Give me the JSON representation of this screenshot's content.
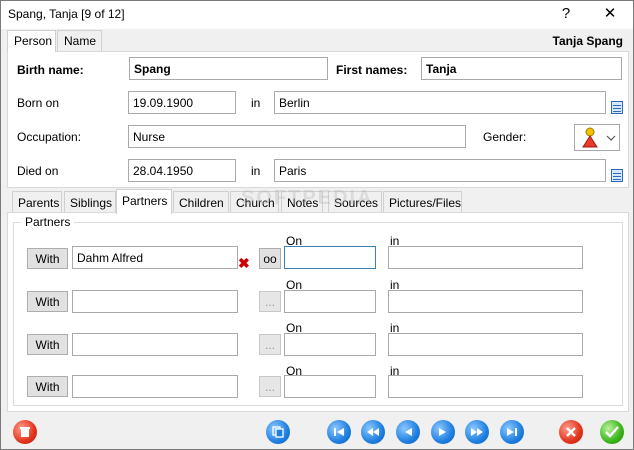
{
  "window": {
    "title": "Spang, Tanja [9 of 12]",
    "help_icon": "?",
    "close_icon": "✕"
  },
  "top_tabs": [
    {
      "label": "Person"
    },
    {
      "label": "Name"
    }
  ],
  "header": {
    "person_name": "Tanja Spang"
  },
  "person": {
    "birth_name_label": "Birth name:",
    "birth_name": "Spang",
    "first_names_label": "First names:",
    "first_names": "Tanja",
    "born_on_label": "Born on",
    "born_on": "19.09.1900",
    "born_in_label": "in",
    "born_in": "Berlin",
    "occupation_label": "Occupation:",
    "occupation": "Nurse",
    "gender_label": "Gender:",
    "gender_icon": "female-person-icon",
    "died_on_label": "Died on",
    "died_on": "28.04.1950",
    "died_in_label": "in",
    "died_in": "Paris"
  },
  "sub_tabs": [
    {
      "label": "Parents"
    },
    {
      "label": "Siblings"
    },
    {
      "label": "Partners"
    },
    {
      "label": "Children"
    },
    {
      "label": "Church"
    },
    {
      "label": "Notes"
    },
    {
      "label": "Sources"
    },
    {
      "label": "Pictures/Files"
    }
  ],
  "watermark": "SOFTPEDIA",
  "partners": {
    "group_title": "Partners",
    "rows": [
      {
        "with_label": "With",
        "name": "Dahm Alfred",
        "oo_label": "oo",
        "on_label": "On",
        "on_value": "",
        "in_label": "in",
        "in_value": ""
      },
      {
        "with_label": "With",
        "name": "",
        "oo_label": "...",
        "on_label": "On",
        "on_value": "",
        "in_label": "in",
        "in_value": ""
      },
      {
        "with_label": "With",
        "name": "",
        "oo_label": "...",
        "on_label": "On",
        "on_value": "",
        "in_label": "in",
        "in_value": ""
      },
      {
        "with_label": "With",
        "name": "",
        "oo_label": "...",
        "on_label": "On",
        "on_value": "",
        "in_label": "in",
        "in_value": ""
      }
    ]
  },
  "toolbar": {
    "delete_icon": "trash-icon",
    "copy_icon": "copy-icon",
    "nav_icons": [
      "first-icon",
      "rewind-icon",
      "previous-icon",
      "next-icon",
      "fast-forward-icon",
      "last-icon"
    ],
    "cancel_icon": "cancel-icon",
    "ok_icon": "ok-check-icon"
  }
}
